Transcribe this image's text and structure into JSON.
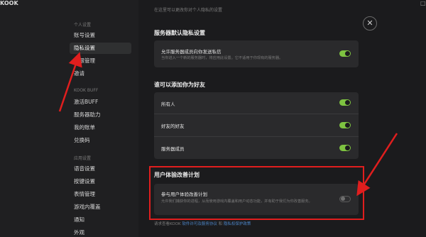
{
  "app": {
    "logo": "KOOK"
  },
  "window": {
    "maximize_glyph": "□"
  },
  "sidebar": {
    "group1_heading": "个人设置",
    "group1_items": [
      "账号设置",
      "隐私设置",
      "权限管理",
      "邀请"
    ],
    "group2_heading": "KOOK BUFF",
    "group2_items": [
      "激活BUFF",
      "服务器助力",
      "我的账单",
      "兑换码"
    ],
    "group3_heading": "应用设置",
    "group3_items": [
      "语音设置",
      "按键设置",
      "表情管理",
      "游戏内覆盖",
      "通知",
      "外观"
    ],
    "active_item": "隐私设置"
  },
  "main": {
    "top_desc": "在这里可以更改你对个人隐私的设置",
    "close_icon": "close-icon",
    "section1": {
      "title": "服务器默认隐私设置",
      "row_title": "允许服务器成员向你发送私信",
      "row_desc": "当你进入一个新的服务器时，将应用此设置。它不适用于你现有的服务器。",
      "toggle": "on"
    },
    "section2": {
      "title": "谁可以添加你为好友",
      "rows": [
        {
          "label": "所有人",
          "toggle": "on"
        },
        {
          "label": "好友的好友",
          "toggle": "on"
        },
        {
          "label": "服务器成员",
          "toggle": "on"
        }
      ]
    },
    "section3": {
      "title": "用户体验改善计划",
      "row_title": "参与用户体验改善计划",
      "row_desc": "允许我们捕获你的进程，从而使用游戏内覆盖和用户动态功能，并有助于我们为你改善服务。",
      "toggle": "off"
    },
    "footer": {
      "prefix": "请求查看KOOK",
      "link1": "软件许可及服务协议",
      "middle": "和",
      "link2": "隐私权保护政策"
    }
  },
  "colors": {
    "accent_green": "#7ec341",
    "annotation_red": "#e01e1e",
    "link_blue": "#4d86c9"
  }
}
